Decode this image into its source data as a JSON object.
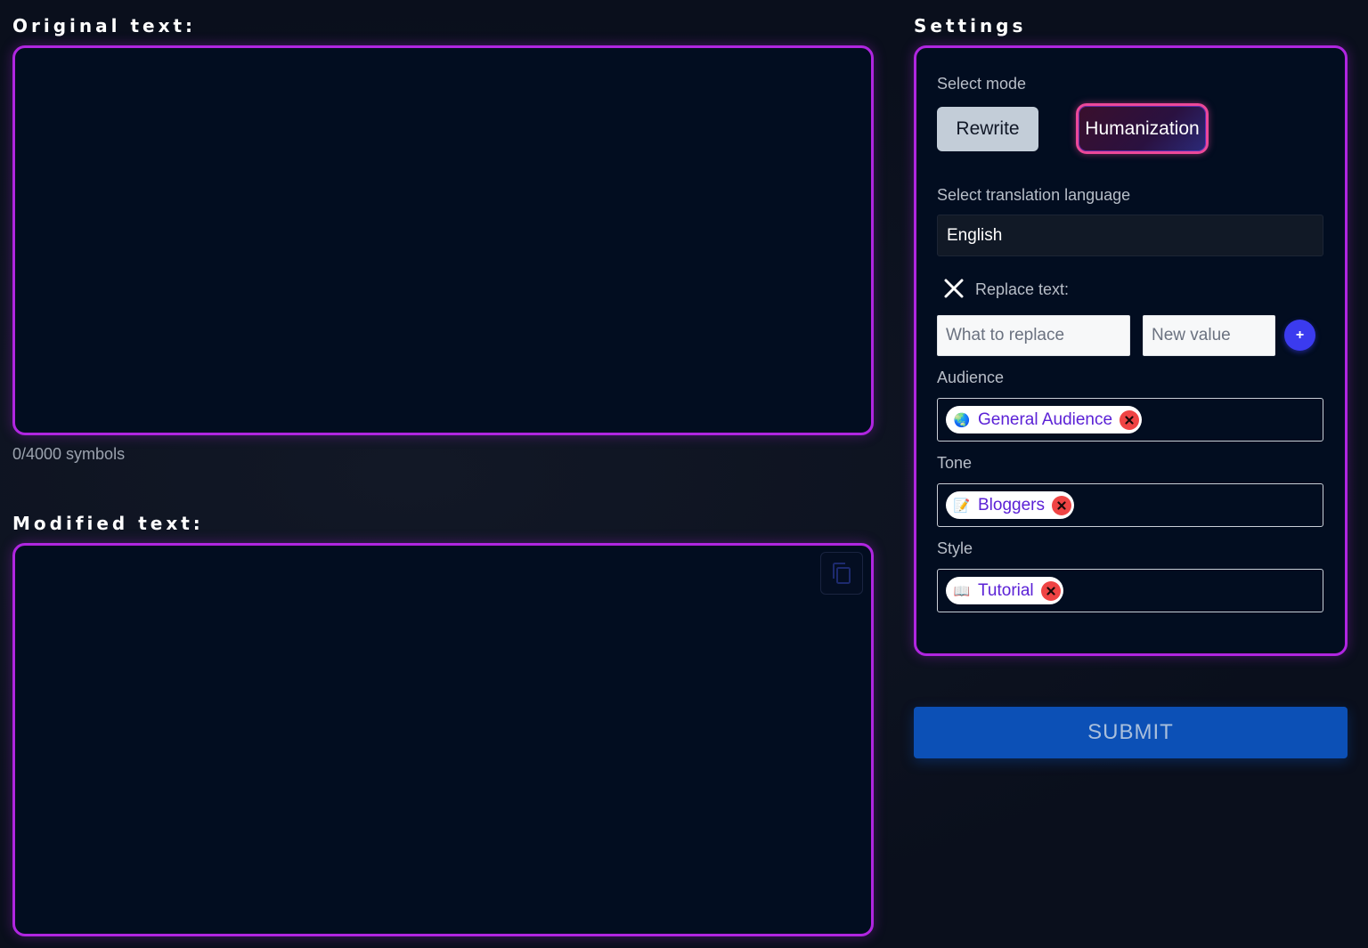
{
  "original": {
    "title": "Original text:",
    "counter": "0/4000 symbols"
  },
  "modified": {
    "title": "Modified text:"
  },
  "settings": {
    "title": "Settings",
    "mode_label": "Select mode",
    "modes": [
      {
        "label": "Rewrite",
        "selected": false
      },
      {
        "label": "Humanization",
        "selected": true
      }
    ],
    "language_label": "Select translation language",
    "language_value": "English",
    "replace": {
      "label": "Replace text:",
      "what_placeholder": "What to replace",
      "new_placeholder": "New value",
      "add_symbol": "+"
    },
    "audience": {
      "label": "Audience",
      "chip": {
        "icon": "globe-icon",
        "emoji": "🌏",
        "label": "General Audience"
      }
    },
    "tone": {
      "label": "Tone",
      "chip": {
        "icon": "memo-icon",
        "emoji": "📝",
        "label": "Bloggers"
      }
    },
    "style": {
      "label": "Style",
      "chip": {
        "icon": "book-icon",
        "emoji": "📖",
        "label": "Tutorial"
      }
    }
  },
  "submit_label": "SUBMIT",
  "colors": {
    "panel_border": "#b026e0",
    "submit_bg": "#0c50b6",
    "chip_text": "#5b21d6",
    "chip_remove": "#ef4444",
    "add_button": "#3b3bef",
    "humanization_border": "#ec4899"
  }
}
